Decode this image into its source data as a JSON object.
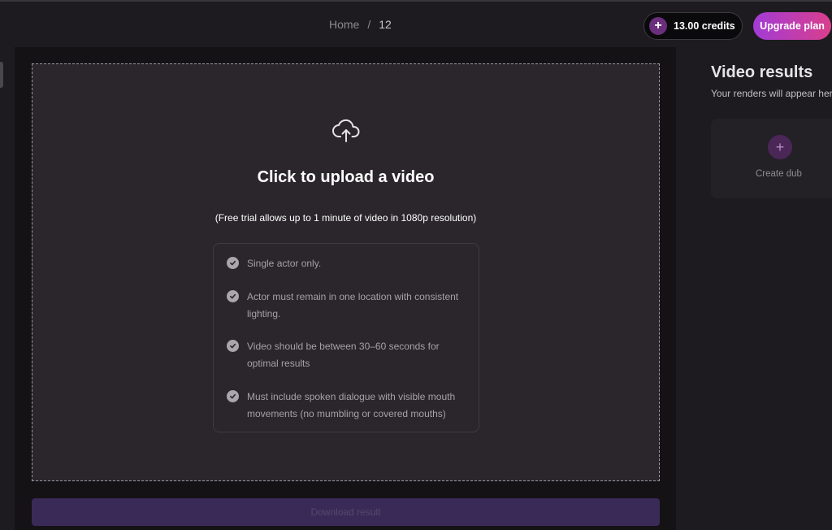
{
  "breadcrumb": {
    "home": "Home",
    "separator": "/",
    "current": "12"
  },
  "credits": {
    "label": "13.00 credits",
    "icon": "plus-icon"
  },
  "upgrade": {
    "label": "Upgrade plan"
  },
  "upload": {
    "title": "Click to upload a video",
    "subtitle": "(Free trial allows up to 1 minute of video in 1080p resolution)",
    "icon": "cloud-upload-icon",
    "requirements": [
      "Single actor only.",
      "Actor must remain in one location with consistent lighting.",
      "Video should be between 30–60 seconds for optimal results",
      "Must include spoken dialogue with visible mouth movements (no mumbling or covered mouths)"
    ]
  },
  "download": {
    "label": "Download result"
  },
  "results": {
    "title": "Video results",
    "subtitle": "Your renders will appear here",
    "create_label": "Create dub",
    "create_icon": "plus-icon"
  },
  "colors": {
    "background": "#1d1b1f",
    "dropzone": "#2a262b",
    "accent_start": "#a33bd6",
    "accent_end": "#d93f8c",
    "download_disabled": "#3a2a58"
  }
}
